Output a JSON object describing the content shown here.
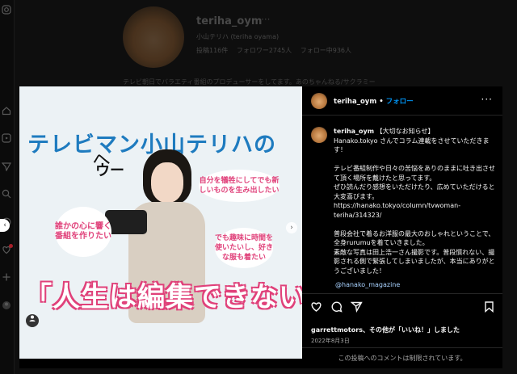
{
  "profile": {
    "username": "teriha_oym",
    "more": "···",
    "full_name": "小山テリハ (teriha oyama)",
    "stats": [
      "投稿116件",
      "フォロワー2745人",
      "フォロー中936人"
    ],
    "bio": "テレビ朝日でバラエティ番組のプロデューサーをしてます。あのちゃんねる/サクラミー"
  },
  "post_image": {
    "headline": "テレビマン小山テリハの",
    "scribble_1": "へ",
    "scribble_2": "ウー",
    "bubble_left": "誰かの心に響く番組を作りたい",
    "bubble_right_1": "自分を犠牲にしてでも新しいものを生み出したい",
    "bubble_right_2": "でも趣味に時間を使いたいし、好きな服も着たい",
    "bottom_title": "「人生は編集できない」",
    "user_tag_icon": "person-icon",
    "next_arrow": "›"
  },
  "side": {
    "username": "teriha_oym",
    "dot": "•",
    "follow": "フォロー",
    "more": "···",
    "caption_user": "teriha_oym",
    "caption": "【大切なお知らせ】\nHanako.tokyo さんでコラム連載をさせていただきます！\n\nテレビ番組制作や日々の苦悩をありのままに吐き出させて頂く場所を戴けたと思ってます。\nぜひ読んだり感想をいただけたり、広めていただけると大変喜びます。\nhttps://hanako.tokyo/column/tvwoman-teriha/314323/\n\n普段会社で着るお洋服の最大のおしゃれということで、全身rurumuを着ていきました。\n素敵な写真は田上浩一さん撮影です。普段慣れない、撮影される側で緊張してしまいましたが、本当にありがとうございました！",
    "mention": "@hanako_magazine",
    "likes_user": "garrettmotors",
    "likes_rest": "、その他が「いいね！」しました",
    "date": "2022年8月3日",
    "comments_disabled": "この投稿へのコメントは制限されています。"
  },
  "nav": {
    "prev": "‹"
  },
  "colors": {
    "accent": "#0095f6",
    "headline": "#1e7bbf",
    "pink": "#e0417a"
  }
}
